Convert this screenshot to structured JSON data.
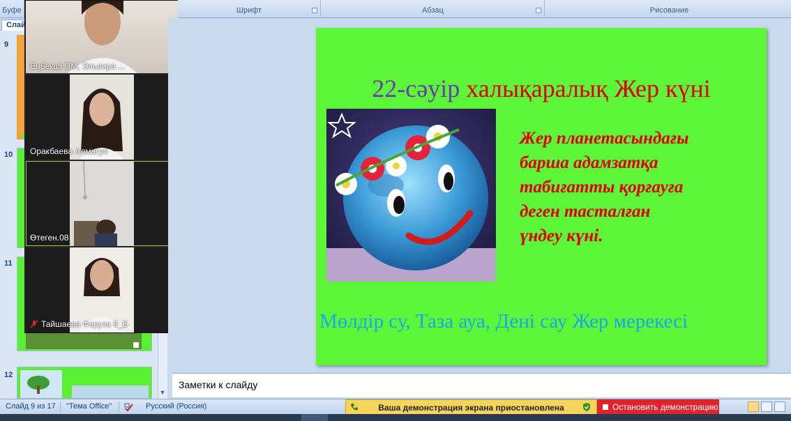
{
  "ribbon": {
    "groups": [
      {
        "label": "Буфе"
      },
      {
        "label": "Шрифт"
      },
      {
        "label": "Абзац"
      },
      {
        "label": "Рисование"
      }
    ]
  },
  "thumbnails": {
    "tab_label": "Слай",
    "slides": [
      {
        "number": "9"
      },
      {
        "number": "10"
      },
      {
        "number": "11"
      },
      {
        "number": "12"
      }
    ]
  },
  "video": {
    "participants": [
      {
        "name": "Еңбекші ОМ, Эльвира ...",
        "muted": false
      },
      {
        "name": "Оракбаева Алмагул",
        "muted": false
      },
      {
        "name": "Өтеген.08",
        "muted": false,
        "active": true
      },
      {
        "name": "Тайшаева Феруза 6_Б",
        "muted": true
      }
    ]
  },
  "slide": {
    "title_date": "22-сәуір",
    "title_rest": "халықаралық Жер күні",
    "body_lines": [
      "Жер планетасындағы",
      "барша адамзатқа",
      "табиғатты қорғауға",
      "деген тасталған",
      "үндеу күні."
    ],
    "bottom_text": "Мөлдір су, Таза ауа, Дені сау Жер  мерекесі",
    "background_color": "#5cf538"
  },
  "notes": {
    "placeholder": "Заметки к слайду"
  },
  "status": {
    "slide_counter": "Слайд 9 из 17",
    "theme": "\"Тема Office\"",
    "language": "Русский (Россия)",
    "share_paused": "Ваша демонстрация экрана приостановлена",
    "stop_share": "Остановить демонстрацию"
  },
  "colors": {
    "accent_red": "#e00000",
    "title_purple": "#6a3bb0",
    "bottom_blue": "#1aa6e8",
    "share_yellow": "#f6d35a",
    "stop_red": "#e0242b"
  }
}
